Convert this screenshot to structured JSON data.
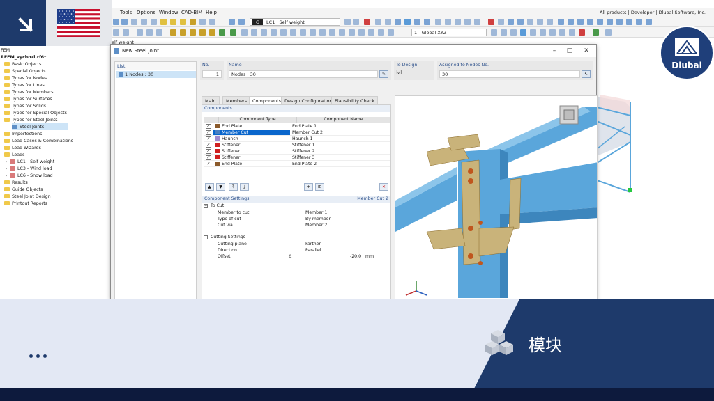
{
  "menubar": {
    "items": [
      "Tools",
      "Options",
      "Window",
      "CAD-BIM",
      "Help"
    ],
    "right_text": "All products | Developer | Dlubal Software, Inc."
  },
  "toolbar": {
    "load_case_badge": "G",
    "load_case_id": "LC1",
    "load_case_name": "Self weight",
    "view_combo": "1 - Global XYZ"
  },
  "partial_label": "elf weight",
  "navigator": {
    "root_partial": "FEM",
    "file": "RFEM_vychozi.rf6*",
    "items": [
      "Basic Objects",
      "Special Objects",
      "Types for Nodes",
      "Types for Lines",
      "Types for Members",
      "Types for Surfaces",
      "Types for Solids",
      "Types for Special Objects",
      "Types for Steel Joints",
      "Steel Joints",
      "Imperfections",
      "Load Cases & Combinations",
      "Load Wizards",
      "Loads",
      "LC1 - Self weight",
      "LC3 - Wind load",
      "LC6 - Snow load",
      "Results",
      "Guide Objects",
      "Steel Joint Design",
      "Printout Reports"
    ]
  },
  "dialog": {
    "title": "New Steel Joint",
    "list_header": "List",
    "list_item": "1  Nodes : 30",
    "no_label": "No.",
    "no_value": "1",
    "name_label": "Name",
    "name_value": "Nodes : 30",
    "to_design_label": "To Design",
    "to_design_checked": "☑",
    "assigned_label": "Assigned to Nodes No.",
    "assigned_value": "30",
    "tabs": [
      "Main",
      "Members",
      "Components",
      "Design Configurations",
      "Plausibility Check"
    ],
    "active_tab": "Components",
    "components_header": "Components",
    "col_type": "Component Type",
    "col_name": "Component Name",
    "components": [
      {
        "type": "End Plate",
        "name": "End Plate 1",
        "color": "#8b5a2b"
      },
      {
        "type": "Member Cut",
        "name": "Member Cut 2",
        "color": "#4a7fc1"
      },
      {
        "type": "Haunch",
        "name": "Haunch 1",
        "color": "#a08bd0"
      },
      {
        "type": "Stiffener",
        "name": "Stiffener 1",
        "color": "#d02020"
      },
      {
        "type": "Stiffener",
        "name": "Stiffener 2",
        "color": "#d02020"
      },
      {
        "type": "Stiffener",
        "name": "Stiffener 3",
        "color": "#d02020"
      },
      {
        "type": "End Plate",
        "name": "End Plate 2",
        "color": "#8b5a2b"
      }
    ],
    "checkbox_glyph": "✓",
    "settings_header": "Component Settings",
    "settings_header_right": "Member Cut 2",
    "to_cut_group": "To Cut",
    "member_to_cut_label": "Member to cut",
    "member_to_cut_value": "Member 1",
    "type_of_cut_label": "Type of cut",
    "type_of_cut_value": "By member",
    "cut_via_label": "Cut via",
    "cut_via_value": "Member 2",
    "cutting_group": "Cutting Settings",
    "cutting_plane_label": "Cutting plane",
    "cutting_plane_value": "Farther",
    "direction_label": "Direction",
    "direction_value": "Parallel",
    "offset_label": "Offset",
    "offset_symbol": "Δ",
    "offset_value": "-20.0",
    "offset_unit": "mm"
  },
  "branding": {
    "logo_text": "Dlubal",
    "module_label": "模块"
  },
  "colors": {
    "brand_navy": "#1e3a6b",
    "steel_blue": "#5aa6db",
    "plate_tan": "#c9b37a",
    "bolt_orange": "#c0561e"
  }
}
